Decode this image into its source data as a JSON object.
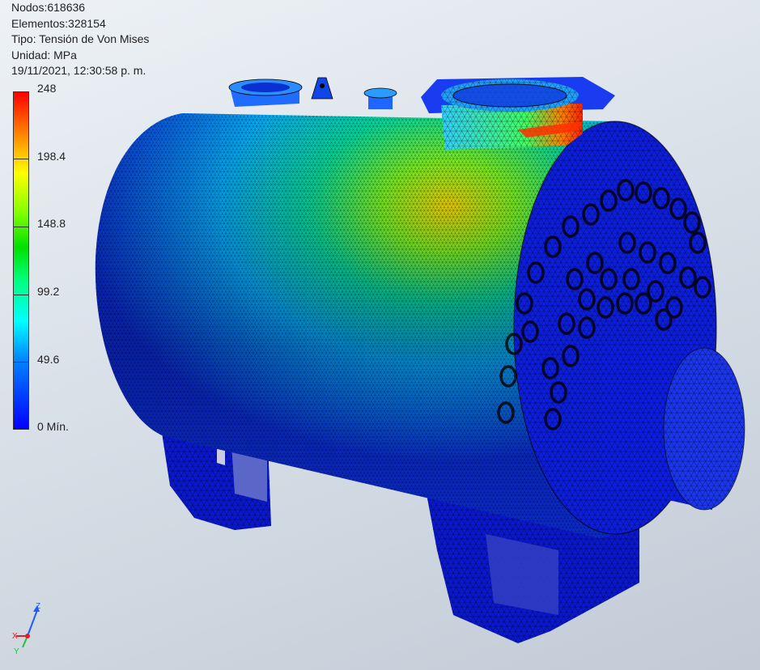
{
  "info": {
    "nodes": "Nodos:618636",
    "elements": "Elementos:328154",
    "type": "Tipo: Tensión de Von Mises",
    "unit": "Unidad: MPa",
    "datetime": "19/11/2021, 12:30:58 p. m."
  },
  "legend": {
    "labels": [
      "248",
      "198.4",
      "148.8",
      "99.2",
      "49.6",
      "0 Mín."
    ]
  },
  "triad": {
    "x": "X",
    "y": "Y",
    "z": "Z"
  },
  "colors": {
    "low": "#0000ff",
    "mid": "#00ff00",
    "high": "#ff0000",
    "axis_z": "#1e5aff",
    "axis_x": "#e02020",
    "axis_y": "#20c040"
  }
}
